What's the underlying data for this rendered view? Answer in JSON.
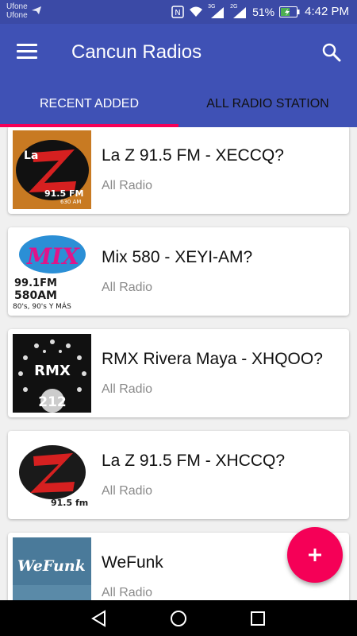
{
  "status_bar": {
    "carrier_1": "Ufone",
    "carrier_2": "Ufone",
    "network_1": "3G",
    "network_2": "2G",
    "battery": "51%",
    "time": "4:42 PM"
  },
  "app_bar": {
    "title": "Cancun Radios"
  },
  "tabs": [
    {
      "label": "RECENT ADDED",
      "active": true
    },
    {
      "label": "ALL RADIO STATION",
      "active": false
    }
  ],
  "stations": [
    {
      "title": "La Z 91.5 FM - XECCQ?",
      "subtitle": "All Radio",
      "logo_text": "91.5 FM",
      "logo_sub": "630 AM"
    },
    {
      "title": "Mix 580 - XEYI-AM?",
      "subtitle": "All Radio",
      "logo_text": "99.1FM",
      "logo_sub": "580AM",
      "logo_extra": "80's, 90's Y MÁS"
    },
    {
      "title": "RMX Rivera Maya - XHQOO?",
      "subtitle": "All Radio",
      "logo_text": "RMX",
      "logo_sub": "212"
    },
    {
      "title": "La Z 91.5 FM - XHCCQ?",
      "subtitle": "All Radio",
      "logo_text": "91.5 fm"
    },
    {
      "title": "WeFunk",
      "subtitle": "All Radio",
      "logo_text": "WeFunk"
    }
  ],
  "colors": {
    "primary": "#3f51b5",
    "status_bar": "#3b4aa6",
    "accent": "#f50057"
  },
  "icons": {
    "menu": "hamburger-menu-icon",
    "search": "search-icon",
    "fab": "plus-icon",
    "back": "back-triangle-icon",
    "home": "home-circle-icon",
    "recents": "recents-square-icon"
  }
}
